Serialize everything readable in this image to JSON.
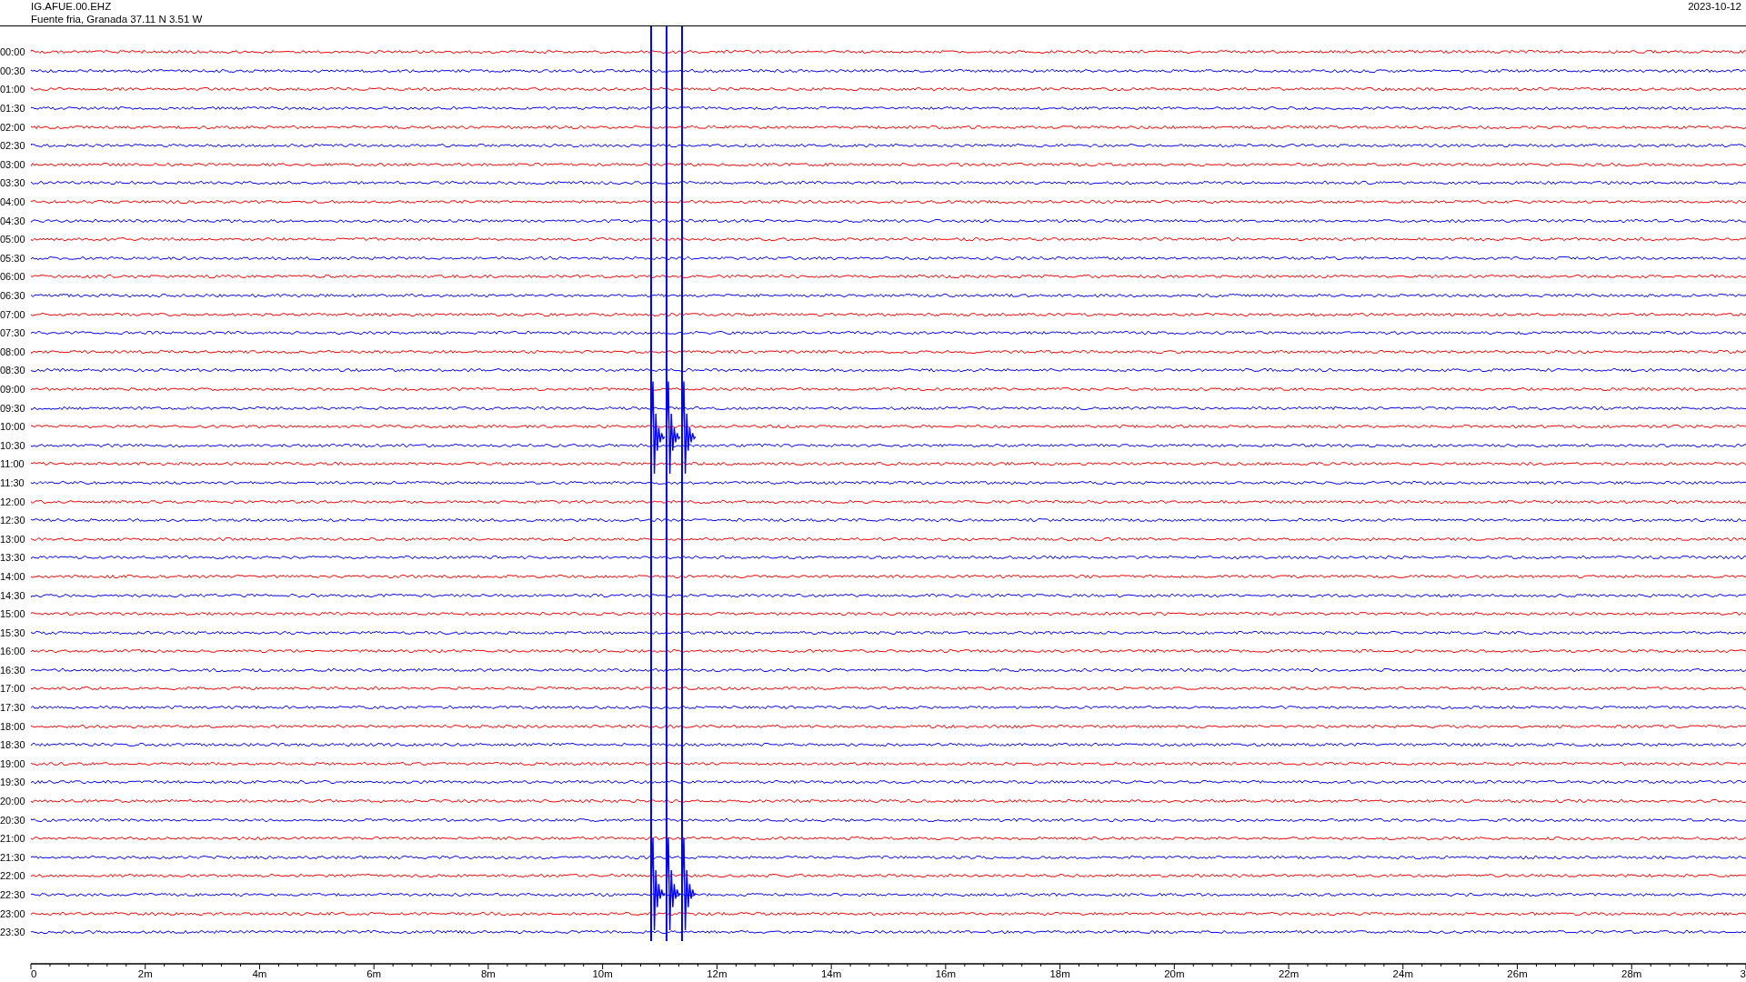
{
  "header": {
    "station": "IG.AFUE.00.EHZ",
    "location": "Fuente fria, Granada  37.11 N 3.51 W",
    "date": "2023-10-12"
  },
  "rows": [
    {
      "label": "00:00",
      "color": "#ff0000"
    },
    {
      "label": "00:30",
      "color": "#0000ff"
    },
    {
      "label": "01:00",
      "color": "#ff0000"
    },
    {
      "label": "01:30",
      "color": "#0000ff"
    },
    {
      "label": "02:00",
      "color": "#ff0000"
    },
    {
      "label": "02:30",
      "color": "#0000ff"
    },
    {
      "label": "03:00",
      "color": "#ff0000"
    },
    {
      "label": "03:30",
      "color": "#0000ff"
    },
    {
      "label": "04:00",
      "color": "#ff0000"
    },
    {
      "label": "04:30",
      "color": "#0000ff"
    },
    {
      "label": "05:00",
      "color": "#ff0000"
    },
    {
      "label": "05:30",
      "color": "#0000ff"
    },
    {
      "label": "06:00",
      "color": "#ff0000"
    },
    {
      "label": "06:30",
      "color": "#0000ff"
    },
    {
      "label": "07:00",
      "color": "#ff0000"
    },
    {
      "label": "07:30",
      "color": "#0000ff"
    },
    {
      "label": "08:00",
      "color": "#ff0000"
    },
    {
      "label": "08:30",
      "color": "#0000ff"
    },
    {
      "label": "09:00",
      "color": "#ff0000"
    },
    {
      "label": "09:30",
      "color": "#0000ff"
    },
    {
      "label": "10:00",
      "color": "#ff0000"
    },
    {
      "label": "10:30",
      "color": "#0000ff"
    },
    {
      "label": "11:00",
      "color": "#ff0000"
    },
    {
      "label": "11:30",
      "color": "#0000ff"
    },
    {
      "label": "12:00",
      "color": "#ff0000"
    },
    {
      "label": "12:30",
      "color": "#0000ff"
    },
    {
      "label": "13:00",
      "color": "#ff0000"
    },
    {
      "label": "13:30",
      "color": "#0000ff"
    },
    {
      "label": "14:00",
      "color": "#ff0000"
    },
    {
      "label": "14:30",
      "color": "#0000ff"
    },
    {
      "label": "15:00",
      "color": "#ff0000"
    },
    {
      "label": "15:30",
      "color": "#0000ff"
    },
    {
      "label": "16:00",
      "color": "#ff0000"
    },
    {
      "label": "16:30",
      "color": "#0000ff"
    },
    {
      "label": "17:00",
      "color": "#ff0000"
    },
    {
      "label": "17:30",
      "color": "#0000ff"
    },
    {
      "label": "18:00",
      "color": "#ff0000"
    },
    {
      "label": "18:30",
      "color": "#0000ff"
    },
    {
      "label": "19:00",
      "color": "#ff0000"
    },
    {
      "label": "19:30",
      "color": "#0000ff"
    },
    {
      "label": "20:00",
      "color": "#ff0000"
    },
    {
      "label": "20:30",
      "color": "#0000ff"
    },
    {
      "label": "21:00",
      "color": "#ff0000"
    },
    {
      "label": "21:30",
      "color": "#0000ff"
    },
    {
      "label": "22:00",
      "color": "#ff0000"
    },
    {
      "label": "22:30",
      "color": "#0000ff"
    },
    {
      "label": "23:00",
      "color": "#ff0000"
    },
    {
      "label": "23:30",
      "color": "#0000ff"
    }
  ],
  "axis": {
    "labels": [
      "0",
      "2m",
      "4m",
      "6m",
      "8m",
      "10m",
      "12m",
      "14m",
      "16m",
      "18m",
      "20m",
      "22m",
      "24m",
      "26m",
      "28m",
      "3"
    ]
  }
}
